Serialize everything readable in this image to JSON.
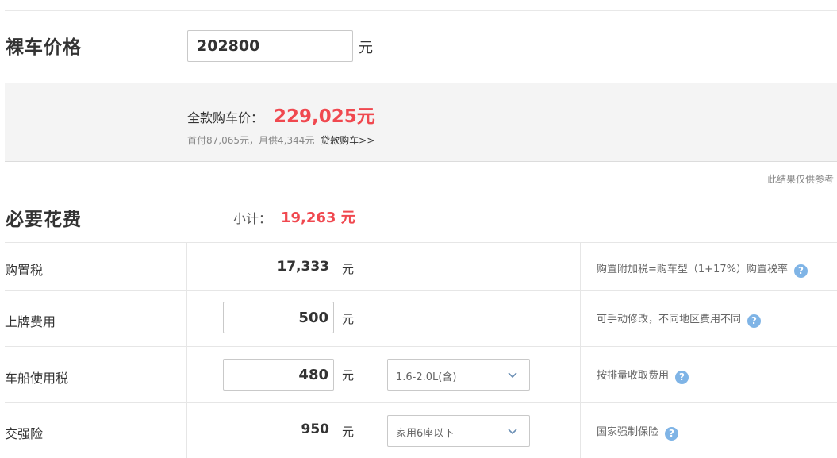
{
  "header": {
    "price_label": "裸车价格",
    "price_value": "202800",
    "price_unit": "元"
  },
  "result": {
    "full_label": "全款购车价：",
    "full_value": "229,025元",
    "down_text": "首付87,065元，月供4,344元",
    "loan_link": "贷款购车>>"
  },
  "disclaimer": "此结果仅供参考",
  "fees": {
    "title": "必要花费",
    "subtotal_label": "小计：",
    "subtotal_value": "19,263 元",
    "rows": [
      {
        "name": "购置税",
        "amount": "17,333",
        "unit": "元",
        "note": "购置附加税=购车型（1+17%）购置税率"
      },
      {
        "name": "上牌费用",
        "amount": "500",
        "unit": "元",
        "note": "可手动修改，不同地区费用不同"
      },
      {
        "name": "车船使用税",
        "amount": "480",
        "unit": "元",
        "select": "1.6-2.0L(含)",
        "note": "按排量收取费用"
      },
      {
        "name": "交强险",
        "amount": "950",
        "unit": "元",
        "select": "家用6座以下",
        "note": "国家强制保险"
      }
    ]
  },
  "icons": {
    "help": "?"
  },
  "colors": {
    "accent_red": "#f0484f",
    "help_blue": "#7fb4e6"
  }
}
